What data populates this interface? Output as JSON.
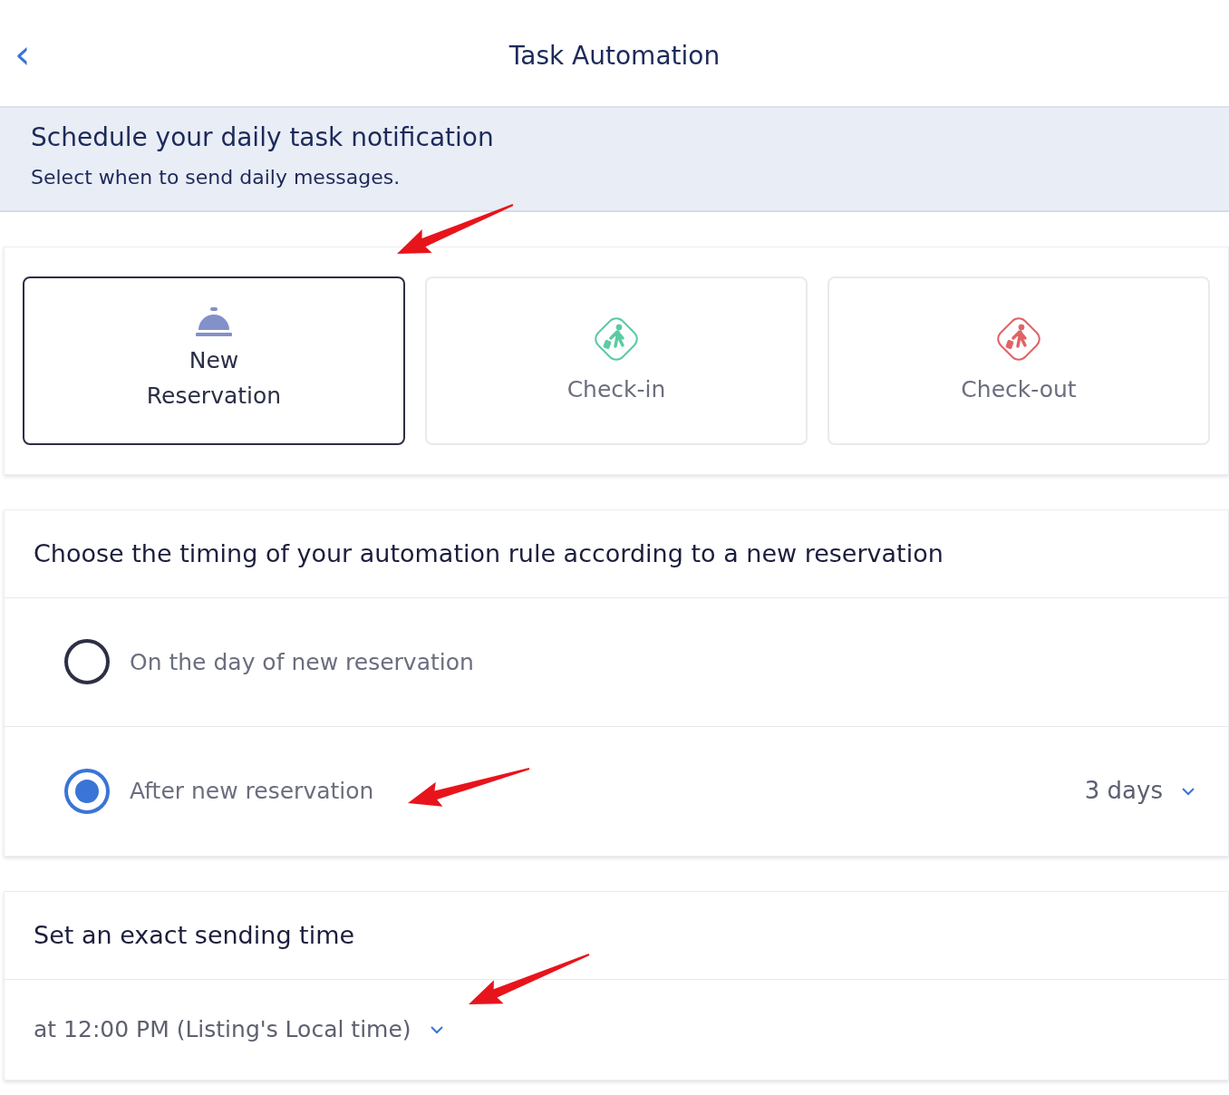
{
  "header": {
    "back": "‹",
    "title": "Task Automation"
  },
  "banner": {
    "title": "Schedule your daily task notification",
    "subtitle": "Select when to send daily messages."
  },
  "events": [
    {
      "kind": "bell",
      "label": "New\nReservation",
      "selected": true
    },
    {
      "kind": "checkin",
      "label": "Check-in",
      "selected": false
    },
    {
      "kind": "checkout",
      "label": "Check-out",
      "selected": false
    }
  ],
  "timing": {
    "title": "Choose the timing of your automation rule according to a new reservation",
    "options": [
      {
        "label": "On the day of new reservation",
        "selected": false
      },
      {
        "label": "After new reservation",
        "selected": true,
        "value": "3 days"
      }
    ]
  },
  "sending": {
    "title": "Set an exact sending time",
    "value": "at 12:00 PM (Listing's Local time)"
  }
}
